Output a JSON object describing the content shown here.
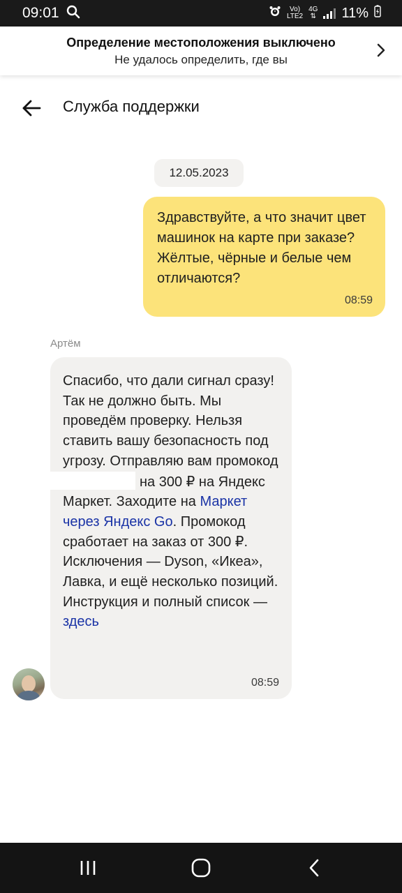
{
  "status_bar": {
    "time": "09:01",
    "network_label_top": "Vo)",
    "network_label_bottom": "LTE2",
    "network_type": "4G",
    "battery": "11%"
  },
  "location_banner": {
    "title": "Определение местоположения выключено",
    "subtitle": "Не удалось определить, где вы"
  },
  "header": {
    "title": "Служба поддержки"
  },
  "chat": {
    "date": "12.05.2023",
    "outgoing": {
      "text": "Здравствуйте, а что значит цвет машинок на карте при заказе? Жёлтые, чёрные и белые чем отличаются?",
      "time": "08:59"
    },
    "incoming": {
      "sender": "Артём",
      "text_part1": "Спасибо, что дали сигнал сразу! Так не должно быть. Мы проведём проверку. Нельзя ставить вашу безопасность под угрозу. Отправляю вам промокод",
      "text_part2": "на 300 ₽ на Яндекс Маркет. Заходите на",
      "link1": "Маркет через Яндекс Go",
      "text_part3": ". Промокод сработает на заказ от 300 ₽. Исключения — Dyson, «Икеа», Лавка, и ещё несколько позиций. Инструкция и полный список —",
      "link2": "здесь",
      "time": "08:59"
    }
  },
  "colors": {
    "outgoing_bubble": "#fce37a",
    "incoming_bubble": "#f2f1ef",
    "link": "#1a33a6"
  }
}
